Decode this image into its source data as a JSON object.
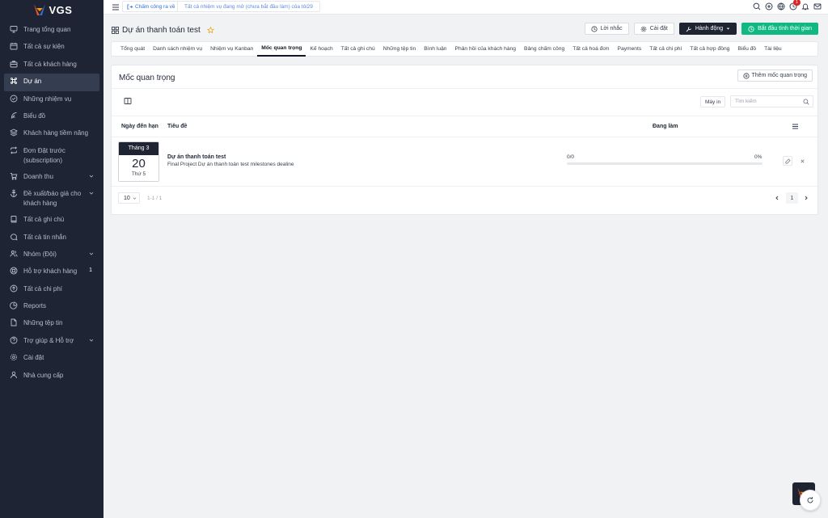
{
  "brand": {
    "name": "VGS"
  },
  "sidebar": {
    "items": [
      {
        "label": "Trang tổng quan",
        "icon": "monitor-icon"
      },
      {
        "label": "Tất cả sự kiện",
        "icon": "calendar-icon"
      },
      {
        "label": "Tất cả khách hàng",
        "icon": "briefcase-icon"
      },
      {
        "label": "Dự án",
        "icon": "command-icon",
        "active": true
      },
      {
        "label": "Những nhiệm vụ",
        "icon": "check-circle-icon"
      },
      {
        "label": "Biểu đồ",
        "icon": "feather-icon"
      },
      {
        "label": "Khách hàng tiềm năng",
        "icon": "layers-icon"
      },
      {
        "label": "Đơn Đặt trước (subscription)",
        "icon": "repeat-icon"
      },
      {
        "label": "Doanh thu",
        "icon": "cart-icon",
        "caret": true
      },
      {
        "label": "Đề xuất/báo giá cho khách hàng",
        "icon": "anchor-icon",
        "caret": true
      },
      {
        "label": "Tất cả ghi chú",
        "icon": "book-icon"
      },
      {
        "label": "Tất cả tin nhắn",
        "icon": "message-icon"
      },
      {
        "label": "Nhóm (Đội)",
        "icon": "users-icon",
        "caret": true
      },
      {
        "label": "Hỗ trợ khách hàng",
        "icon": "lifebuoy-icon",
        "badge": "1"
      },
      {
        "label": "Tất cả chi phí",
        "icon": "arrow-circle-icon"
      },
      {
        "label": "Reports",
        "icon": "pie-chart-icon"
      },
      {
        "label": "Những tệp tin",
        "icon": "file-icon"
      },
      {
        "label": "Trợ giúp & Hỗ trợ",
        "icon": "help-circle-icon",
        "caret": true
      },
      {
        "label": "Cài đặt",
        "icon": "settings-icon"
      },
      {
        "label": "Nhà cung cấp",
        "icon": "user-icon"
      }
    ]
  },
  "topbar": {
    "checkin_label": "Chấm công ra về",
    "task_text": "Tất cả nhiệm vụ đang mở (chưa bắt đầu làm) của tôi29",
    "notification_count": "1"
  },
  "project": {
    "title": "Dự án thanh toán test",
    "buttons": {
      "reminder": "Lời nhắc",
      "settings": "Cài đặt",
      "actions": "Hành động",
      "start_timer": "Bắt đầu tính thời gian"
    }
  },
  "tabs": [
    {
      "label": "Tổng quát"
    },
    {
      "label": "Danh sách nhiệm vụ"
    },
    {
      "label": "Nhiệm vụ Kanban"
    },
    {
      "label": "Mốc quan trọng",
      "active": true
    },
    {
      "label": "Kế hoạch"
    },
    {
      "label": "Tất cả ghi chú"
    },
    {
      "label": "Những tệp tin"
    },
    {
      "label": "Bình luận"
    },
    {
      "label": "Phản hồi của khách hàng"
    },
    {
      "label": "Bảng chấm công"
    },
    {
      "label": "Tất cả hoá đơn"
    },
    {
      "label": "Payments"
    },
    {
      "label": "Tất cả chi phí"
    },
    {
      "label": "Tất cả hợp đồng"
    },
    {
      "label": "Biểu đồ"
    },
    {
      "label": "Tài liệu"
    }
  ],
  "milestones": {
    "title": "Mốc quan trọng",
    "add_label": "Thêm mốc quan trọng",
    "print_label": "Máy in",
    "search_placeholder": "Tìm kiếm",
    "columns": {
      "due": "Ngày đến hạn",
      "title": "Tiêu đề",
      "progress": "Đang làm"
    },
    "rows": [
      {
        "month": "Tháng 3",
        "day": "20",
        "weekday": "Thứ 5",
        "title": "Dự án thanh toán test",
        "description": "Final Project Dự án thanh toán test milestones dealine",
        "progress_count": "0/0",
        "progress_pct": "0%",
        "progress_value": 0
      }
    ],
    "pagination": {
      "page_size": "10",
      "info": "1-1 / 1",
      "current": "1"
    }
  }
}
